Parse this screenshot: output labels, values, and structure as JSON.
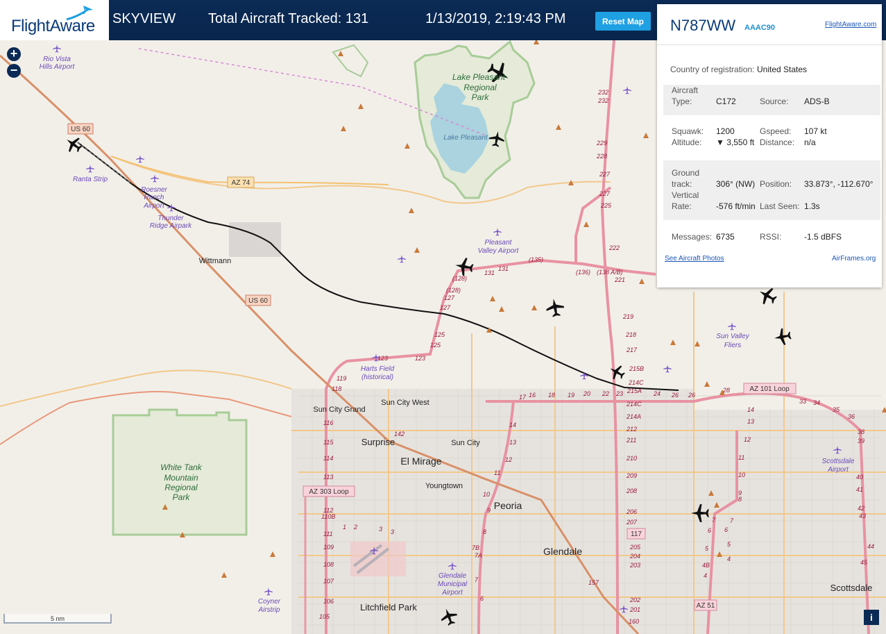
{
  "header": {
    "logo": "FlightAware",
    "app_name": "SKYVIEW",
    "aircraft_count": "Total Aircraft Tracked: 131",
    "datetime": "1/13/2019, 2:19:43 PM",
    "reset_label": "Reset Map"
  },
  "panel": {
    "registration": "N787WW",
    "hex": "AAAC90",
    "site_link": "FlightAware.com",
    "country_label": "Country of registration:",
    "country_value": "United States",
    "aircraft_type_label": "Aircraft Type:",
    "aircraft_type_value": "C172",
    "source_label": "Source:",
    "source_value": "ADS-B",
    "squawk_label": "Squawk:",
    "squawk_value": "1200",
    "gspeed_label": "Gspeed:",
    "gspeed_value": "107 kt",
    "altitude_label": "Altitude:",
    "altitude_value": "▼ 3,550 ft",
    "distance_label": "Distance:",
    "distance_value": "n/a",
    "ground_track_label": "Ground track:",
    "ground_track_value": "306° (NW)",
    "position_label": "Position:",
    "position_value": "33.873°, -112.670°",
    "vertical_rate_label": "Vertical Rate:",
    "vertical_rate_value": "-576 ft/min",
    "last_seen_label": "Last Seen:",
    "last_seen_value": "1.3s",
    "messages_label": "Messages:",
    "messages_value": "6735",
    "rssi_label": "RSSI:",
    "rssi_value": "-1.5 dBFS",
    "photos_link": "See Aircraft Photos",
    "airframes_link": "AirFrames.org"
  },
  "map": {
    "zoom_in": "+",
    "zoom_out": "−",
    "scale": "5 nm",
    "info": "i",
    "places": {
      "rio_vista_1": "Rio Vista",
      "rio_vista_2": "Hills Airport",
      "lake_pleasant_park_1": "Lake Pleasant",
      "lake_pleasant_park_2": "Regional",
      "lake_pleasant_park_3": "Park",
      "lake_pleasant": "Lake Pleasant",
      "ranta": "Ranta Strip",
      "roesner_1": "Roesner",
      "roesner_2": "Ranch",
      "roesner_3": "Airport",
      "thunder_1": "Thunder",
      "thunder_2": "Ridge Airpark",
      "wittmann": "Wittmann",
      "pleasant_valley_1": "Pleasant",
      "pleasant_valley_2": "Valley Airport",
      "sun_valley_1": "Sun Valley",
      "sun_valley_2": "Fliers",
      "harts_1": "Harts Field",
      "harts_2": "(historical)",
      "sun_city_grand": "Sun City Grand",
      "sun_city_west": "Sun City West",
      "surprise": "Surprise",
      "sun_city": "Sun City",
      "el_mirage": "El Mirage",
      "youngtown": "Youngtown",
      "peoria": "Peoria",
      "glendale": "Glendale",
      "glendale_airport_1": "Glendale",
      "glendale_airport_2": "Municipal",
      "glendale_airport_3": "Airport",
      "scottsdale_airport_1": "Scottsdale",
      "scottsdale_airport_2": "Airport",
      "scottsdale": "Scottsdale",
      "litchfield": "Litchfield Park",
      "coyner_1": "Coyner",
      "coyner_2": "Airstrip",
      "white_tank_1": "White Tank",
      "white_tank_2": "Mountain",
      "white_tank_3": "Regional",
      "white_tank_4": "Park"
    },
    "shields": {
      "us60_a": "US 60",
      "us60_b": "US 60",
      "az74": "AZ 74",
      "az101": "AZ 101 Loop",
      "az303": "AZ 303 Loop",
      "r117": "117",
      "az51": "AZ 51"
    },
    "exits": {
      "e232a": "232",
      "e232b": "232",
      "e229": "229",
      "e228": "228",
      "e227a": "227",
      "e227b": "227",
      "e225": "225",
      "e222": "222",
      "e221": "221",
      "e219": "219",
      "e218": "218",
      "e217": "217",
      "e215b": "215B",
      "e214c": "214C",
      "e215a": "215A",
      "e214c2": "214C",
      "e214a": "214A",
      "e212": "212",
      "e211": "211",
      "e210": "210",
      "e209": "209",
      "e208": "208",
      "e207": "207",
      "e206": "206",
      "e205": "205",
      "e204": "204",
      "e203": "203",
      "e202": "202",
      "e201": "201",
      "e160": "160",
      "r131a": "131",
      "r131b": "131",
      "r135": "(135)",
      "r136": "(136)",
      "r138": "(138 A/B)",
      "r128a": "(128)",
      "r128b": "(128)",
      "r127a": "127",
      "r127b": "127",
      "r125a": "125",
      "r125b": "125",
      "r123a": "123",
      "r123b": "123",
      "r119": "119",
      "r118": "118",
      "r116": "116",
      "r115": "115",
      "r114": "114",
      "r113": "113",
      "r112": "112",
      "r110b": "110B",
      "r111": "111",
      "r109": "109",
      "r108": "108",
      "r107": "107",
      "r106": "106",
      "r105": "105",
      "r142": "142",
      "l16": "16",
      "l17": "17",
      "l18": "18",
      "l19": "19",
      "l20": "20",
      "l22": "22",
      "l23": "23",
      "l24": "24",
      "l26a": "26",
      "l26b": "26",
      "l28": "28",
      "l33": "33",
      "l34": "34",
      "l35": "35",
      "l36": "36",
      "l38": "38",
      "l39": "39",
      "l40": "40",
      "l41": "41",
      "l42": "42",
      "l43": "43",
      "l44": "44",
      "l45": "45",
      "p14a": "14",
      "p13": "13",
      "p12a": "12",
      "s14": "14",
      "s13": "13",
      "s12": "12",
      "s11": "11",
      "s10": "10",
      "s9": "9",
      "g1": "1",
      "g2": "2",
      "g3a": "3",
      "g3b": "3",
      "a8": "8",
      "a7b": "7B",
      "a7a": "7A",
      "a7": "7",
      "a6": "6",
      "b7": "7",
      "b6": "6",
      "b5": "5",
      "b4b": "4B",
      "b4": "4",
      "c11": "11",
      "c10": "10",
      "c9": "9",
      "c8": "8",
      "c7": "7",
      "c6": "6",
      "c5": "5",
      "c4": "4",
      "e157": "157"
    }
  }
}
